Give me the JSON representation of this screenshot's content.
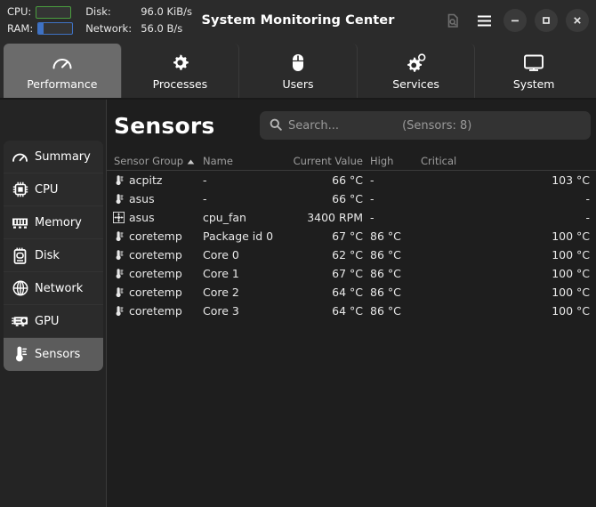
{
  "window": {
    "title": "System Monitoring Center",
    "stats": {
      "cpu_label": "CPU:",
      "ram_label": "RAM:",
      "disk_label": "Disk:",
      "disk_value": "96.0 KiB/s",
      "network_label": "Network:",
      "network_value": "56.0 B/s",
      "cpu_color": "#4a9e3f",
      "ram_color": "#3f72c4"
    },
    "controls": [
      {
        "name": "page-search-icon",
        "label": ""
      },
      {
        "name": "menu-icon",
        "label": ""
      },
      {
        "name": "minimize-button",
        "label": ""
      },
      {
        "name": "maximize-button",
        "label": ""
      },
      {
        "name": "close-button",
        "label": ""
      }
    ]
  },
  "tabs": [
    {
      "label": "Performance",
      "icon": "gauge-icon",
      "active": true
    },
    {
      "label": "Processes",
      "icon": "gear-icon",
      "active": false
    },
    {
      "label": "Users",
      "icon": "mouse-icon",
      "active": false
    },
    {
      "label": "Services",
      "icon": "gears-icon",
      "active": false
    },
    {
      "label": "System",
      "icon": "monitor-icon",
      "active": false
    }
  ],
  "sidebar": {
    "items": [
      {
        "label": "Summary",
        "icon": "gauge-icon",
        "active": false
      },
      {
        "label": "CPU",
        "icon": "cpu-chip-icon",
        "active": false
      },
      {
        "label": "Memory",
        "icon": "memory-stick-icon",
        "active": false
      },
      {
        "label": "Disk",
        "icon": "disk-icon",
        "active": false
      },
      {
        "label": "Network",
        "icon": "globe-icon",
        "active": false
      },
      {
        "label": "GPU",
        "icon": "gpu-card-icon",
        "active": false
      },
      {
        "label": "Sensors",
        "icon": "thermometer-icon",
        "active": true
      }
    ]
  },
  "main": {
    "title": "Sensors",
    "search": {
      "placeholder": "Search...",
      "value": "",
      "count_label": "(Sensors: 8)"
    },
    "table": {
      "columns": [
        {
          "key": "group",
          "label": "Sensor Group",
          "sort": "asc"
        },
        {
          "key": "name",
          "label": "Name"
        },
        {
          "key": "current",
          "label": "Current Value"
        },
        {
          "key": "high",
          "label": "High"
        },
        {
          "key": "critical",
          "label": "Critical"
        }
      ],
      "rows": [
        {
          "icon": "thermometer-icon",
          "group": "acpitz",
          "name": "-",
          "current": "66 °C",
          "high": "-",
          "critical": "103 °C"
        },
        {
          "icon": "thermometer-icon",
          "group": "asus",
          "name": "-",
          "current": "66 °C",
          "high": "-",
          "critical": "-"
        },
        {
          "icon": "fan-icon",
          "group": "asus",
          "name": "cpu_fan",
          "current": "3400 RPM",
          "high": "-",
          "critical": "-"
        },
        {
          "icon": "thermometer-icon",
          "group": "coretemp",
          "name": "Package id 0",
          "current": "67 °C",
          "high": "86 °C",
          "critical": "100 °C"
        },
        {
          "icon": "thermometer-icon",
          "group": "coretemp",
          "name": "Core 0",
          "current": "62 °C",
          "high": "86 °C",
          "critical": "100 °C"
        },
        {
          "icon": "thermometer-icon",
          "group": "coretemp",
          "name": "Core 1",
          "current": "67 °C",
          "high": "86 °C",
          "critical": "100 °C"
        },
        {
          "icon": "thermometer-icon",
          "group": "coretemp",
          "name": "Core 2",
          "current": "64 °C",
          "high": "86 °C",
          "critical": "100 °C"
        },
        {
          "icon": "thermometer-icon",
          "group": "coretemp",
          "name": "Core 3",
          "current": "64 °C",
          "high": "86 °C",
          "critical": "100 °C"
        }
      ]
    }
  }
}
